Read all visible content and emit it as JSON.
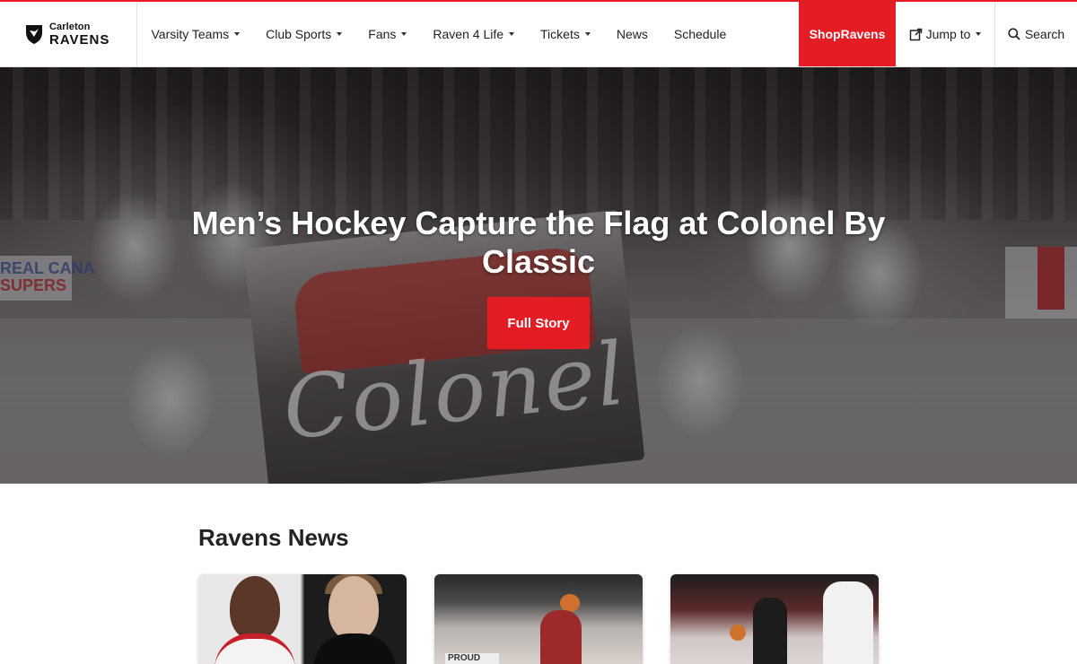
{
  "brand": {
    "line1": "Carleton",
    "line2": "RAVENS"
  },
  "nav": {
    "items": [
      {
        "label": "Varsity Teams",
        "dropdown": true
      },
      {
        "label": "Club Sports",
        "dropdown": true
      },
      {
        "label": "Fans",
        "dropdown": true
      },
      {
        "label": "Raven 4 Life",
        "dropdown": true
      },
      {
        "label": "Tickets",
        "dropdown": true
      },
      {
        "label": "News",
        "dropdown": false
      },
      {
        "label": "Schedule",
        "dropdown": false
      }
    ],
    "shop_label": "ShopRavens",
    "jump_label": "Jump to",
    "search_label": "Search"
  },
  "hero": {
    "title": "Men’s Hockey Capture the Flag at Colonel By Classic",
    "button_label": "Full Story",
    "flag_text": "Colonel",
    "board_text_line1": "REAL CANA",
    "board_text_line2": "SUPERS"
  },
  "news": {
    "heading": "Ravens News",
    "cards": [
      {
        "name": "news-card-1"
      },
      {
        "name": "news-card-2",
        "banner_text": "PROUD"
      },
      {
        "name": "news-card-3"
      }
    ]
  },
  "colors": {
    "accent": "#e41c24",
    "text": "#222222"
  }
}
